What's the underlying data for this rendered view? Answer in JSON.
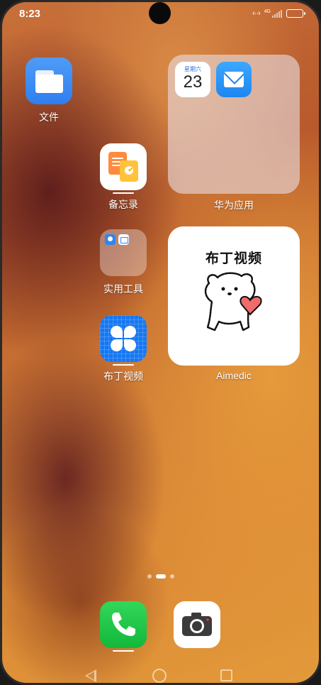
{
  "status_bar": {
    "time": "8:23",
    "network": "‹··›",
    "signal_label": "4G"
  },
  "apps": {
    "files": {
      "label": "文件"
    },
    "memo": {
      "label": "备忘录"
    },
    "tools_folder": {
      "label": "实用工具"
    },
    "pudding": {
      "label": "布丁视频"
    }
  },
  "huawei_folder": {
    "label": "华为应用",
    "calendar_weekday": "星期六",
    "calendar_day": "23"
  },
  "pudding_widget": {
    "title": "布丁视频",
    "label": "Aimedic"
  },
  "page_indicator": {
    "pages": 3,
    "current": 2
  },
  "dock": {
    "phone_icon": "phone-icon",
    "camera_icon": "camera-icon"
  },
  "colors": {
    "accent_blue": "#1677f2",
    "phone_green": "#12b83a",
    "memo_orange": "#ff8a3d"
  }
}
